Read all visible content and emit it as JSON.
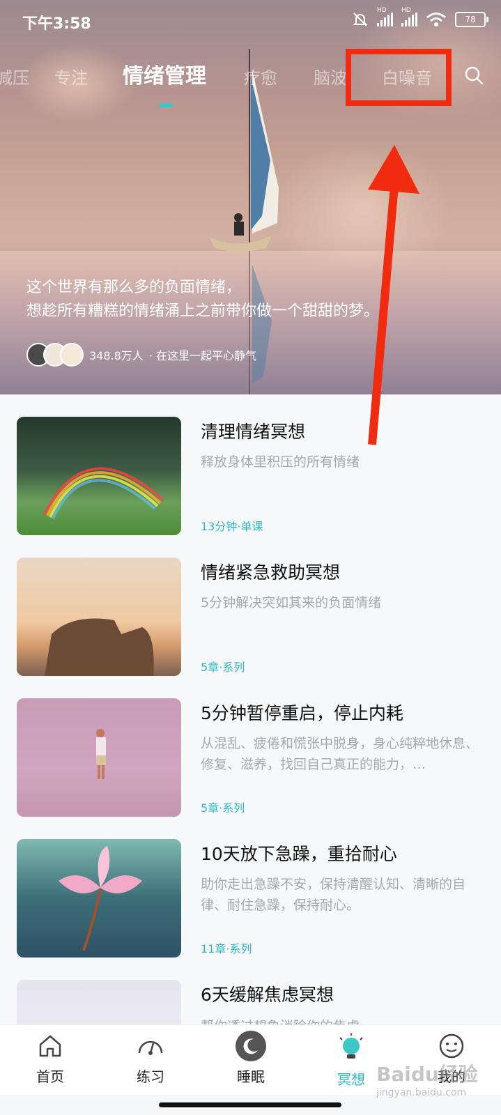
{
  "status_bar": {
    "time": "下午3:58",
    "signal1_label": "HD",
    "signal2_label": "HD",
    "battery": "78"
  },
  "tabs": [
    {
      "label": "减压"
    },
    {
      "label": "专注"
    },
    {
      "label": "情绪管理"
    },
    {
      "label": "疗愈"
    },
    {
      "label": "脑波"
    },
    {
      "label": "白噪音"
    }
  ],
  "hero": {
    "line1": "这个世界有那么多的负面情绪，",
    "line2": "想趁所有糟糕的情绪涌上之前带你做一个甜甜的梦。",
    "community_count": "348.8万人",
    "community_text": "· 在这里一起平心静气"
  },
  "items": [
    {
      "title": "清理情绪冥想",
      "desc": "释放身体里积压的所有情绪",
      "meta": "13分钟·单课"
    },
    {
      "title": "情绪紧急救助冥想",
      "desc": "5分钟解决突如其来的负面情绪",
      "meta": "5章·系列"
    },
    {
      "title": "5分钟暂停重启，停止内耗",
      "desc": "从混乱、疲倦和慌张中脱身，身心纯粹地休息、修复、滋养，找回自己真正的能力，…",
      "meta": "5章·系列"
    },
    {
      "title": "10天放下急躁，重拾耐心",
      "desc": "助你走出急躁不安，保持清醒认知、清晰的自律、耐住急躁，保持耐心。",
      "meta": "11章·系列"
    },
    {
      "title": "6天缓解焦虑冥想",
      "desc": "帮你透过想象消除你的焦虑",
      "meta": ""
    }
  ],
  "nav": [
    {
      "label": "首页"
    },
    {
      "label": "练习"
    },
    {
      "label": "睡眠"
    },
    {
      "label": "冥想"
    },
    {
      "label": "我的"
    }
  ],
  "watermark": {
    "brand": "Baidu经验",
    "url": "jingyan.baidu.com"
  },
  "colors": {
    "accent": "#2eb8c5",
    "annotation": "#f02b10"
  }
}
